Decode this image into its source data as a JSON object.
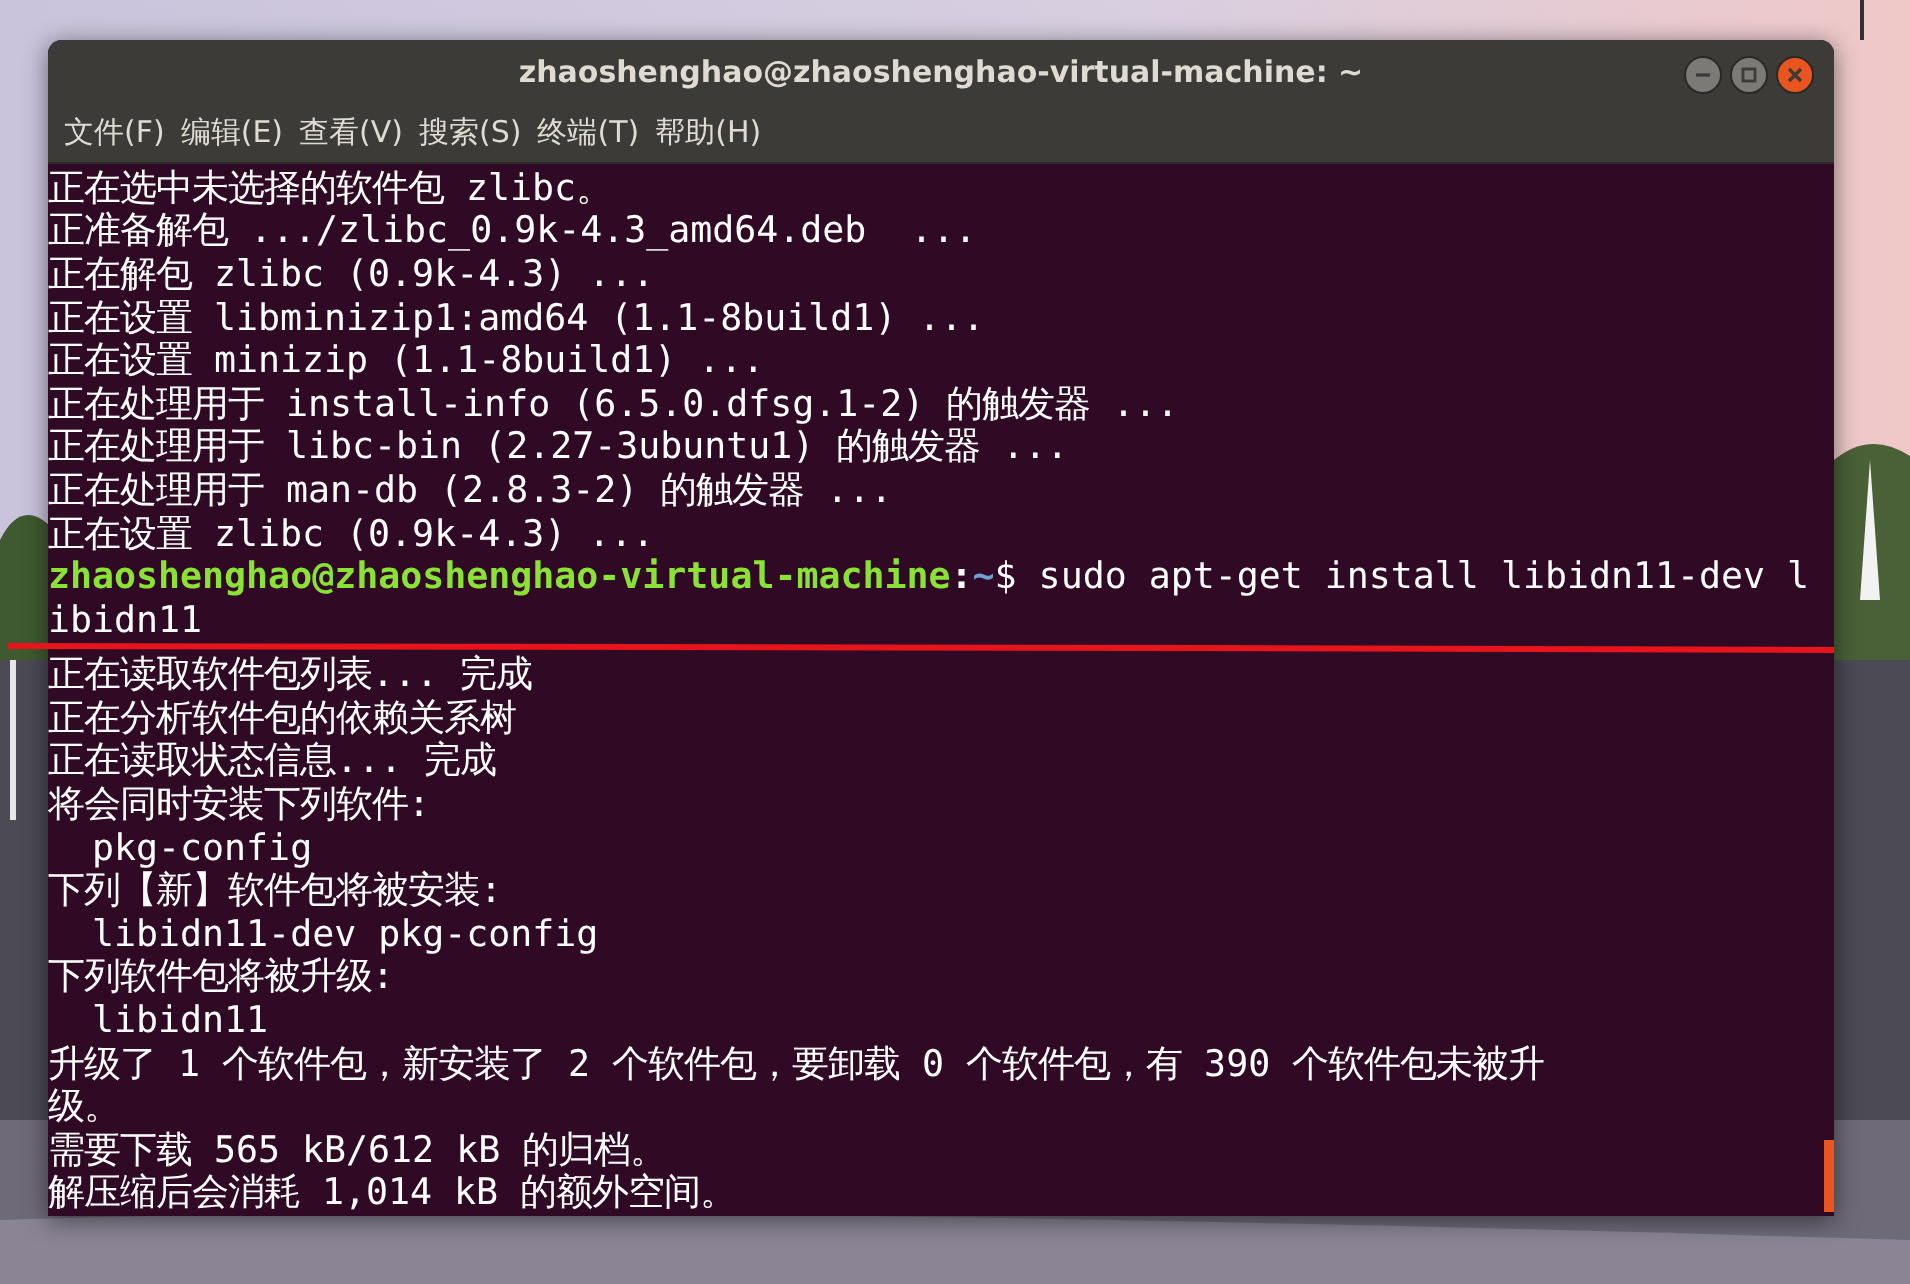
{
  "window": {
    "title": "zhaoshenghao@zhaoshenghao-virtual-machine: ~"
  },
  "menu": [
    "文件(F)",
    "编辑(E)",
    "查看(V)",
    "搜索(S)",
    "终端(T)",
    "帮助(H)"
  ],
  "output_before": [
    "正在选中未选择的软件包 zlibc。",
    "正准备解包 .../zlibc_0.9k-4.3_amd64.deb  ...",
    "正在解包 zlibc (0.9k-4.3) ...",
    "正在设置 libminizip1:amd64 (1.1-8build1) ...",
    "正在设置 minizip (1.1-8build1) ...",
    "正在处理用于 install-info (6.5.0.dfsg.1-2) 的触发器 ...",
    "正在处理用于 libc-bin (2.27-3ubuntu1) 的触发器 ...",
    "正在处理用于 man-db (2.8.3-2) 的触发器 ...",
    "正在设置 zlibc (0.9k-4.3) ..."
  ],
  "prompt": {
    "user_host": "zhaoshenghao@zhaoshenghao-virtual-machine",
    "separator": ":",
    "path": "~",
    "command": "$ sudo apt-get install libidn11-dev l"
  },
  "command_wrap": "ibidn11",
  "output_after": [
    "正在读取软件包列表... 完成",
    "正在分析软件包的依赖关系树",
    "正在读取状态信息... 完成",
    "将会同时安装下列软件:",
    "  pkg-config",
    "下列【新】软件包将被安装:",
    "  libidn11-dev pkg-config",
    "下列软件包将被升级:",
    "  libidn11",
    "升级了 1 个软件包，新安装了 2 个软件包，要卸载 0 个软件包，有 390 个软件包未被升",
    "级。",
    "需要下载 565 kB/612 kB 的归档。",
    "解压缩后会消耗 1,014 kB 的额外空间。"
  ]
}
